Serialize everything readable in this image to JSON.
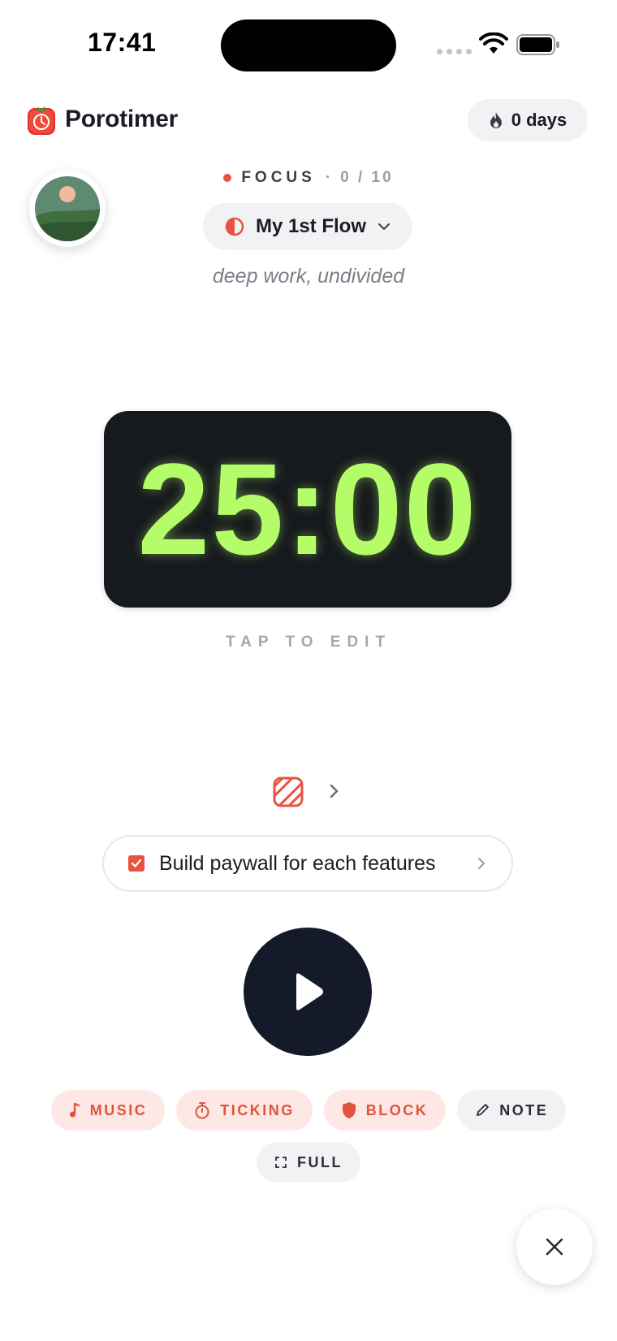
{
  "status_bar": {
    "time": "17:41"
  },
  "header": {
    "brand": "Porotimer",
    "streak_label": "0 days"
  },
  "session": {
    "mode_label": "FOCUS",
    "separator": "·",
    "count": "0 / 10",
    "flow_name": "My 1st Flow",
    "tagline": "deep work, undivided"
  },
  "timer": {
    "display": "25:00",
    "hint": "TAP TO EDIT"
  },
  "task": {
    "title": "Build paywall for each features"
  },
  "chips": {
    "music": "MUSIC",
    "ticking": "TICKING",
    "block": "BLOCK",
    "note": "NOTE",
    "full": "FULL"
  },
  "colors": {
    "accent": "#e8533f",
    "timer_bg": "#16191d",
    "timer_text": "#b4fd68",
    "play_bg": "#141a29"
  },
  "icons": {
    "logo": "tomato-clock-icon",
    "streak": "flame-icon",
    "flow": "half-circle-icon",
    "task_group": "striped-square-icon",
    "play": "play-icon",
    "close": "close-icon"
  }
}
